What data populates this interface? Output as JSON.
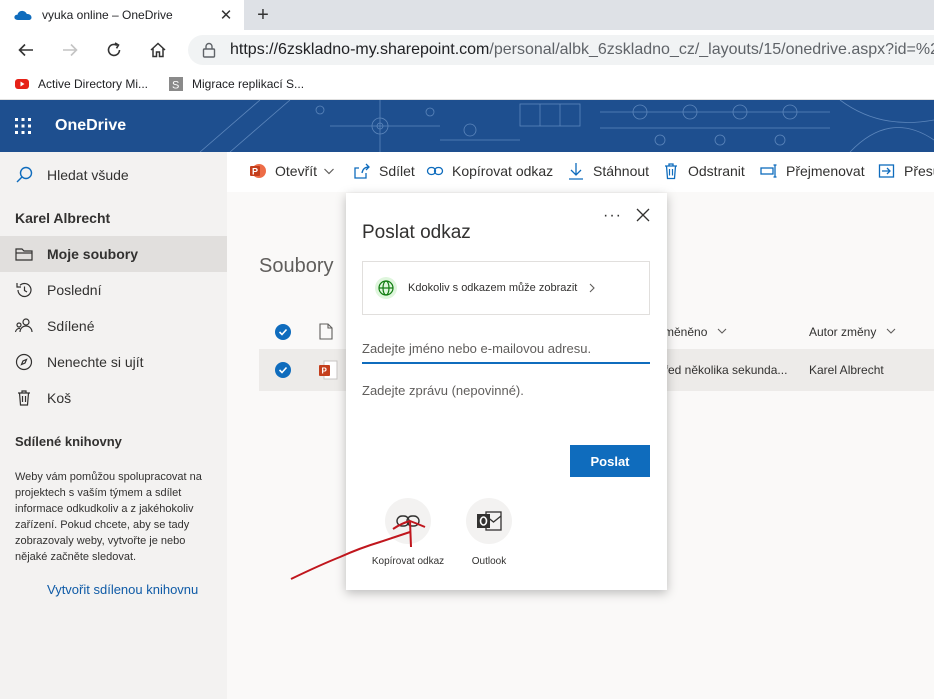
{
  "browser": {
    "tab_title": "vyuka online – OneDrive",
    "tab_close": "✕",
    "new_tab": "+",
    "url_host": "https://6zskladno-my.sharepoint.com",
    "url_path": "/personal/albk_6zskladno_cz/_layouts/15/onedrive.aspx?id=%2",
    "bookmarks": [
      "Active Directory Mi...",
      "Migrace replikací S..."
    ]
  },
  "suite": {
    "brand": "OneDrive"
  },
  "leftnav": {
    "search_label": "Hledat všude",
    "user_name": "Karel Albrecht",
    "items": [
      {
        "label": "Moje soubory",
        "icon": "folder-icon"
      },
      {
        "label": "Poslední",
        "icon": "history-icon"
      },
      {
        "label": "Sdílené",
        "icon": "people-icon"
      },
      {
        "label": "Nenechte si ujít",
        "icon": "diamond-icon"
      },
      {
        "label": "Koš",
        "icon": "trash-icon"
      }
    ],
    "shared_libraries_title": "Sdílené knihovny",
    "shared_libraries_text": "Weby vám pomůžou spolupracovat na projektech s vaším týmem a sdílet informace odkudkoliv a z jakéhokoliv zařízení. Pokud chcete, aby se tady zobrazovaly weby, vytvořte je nebo nějaké začněte sledovat.",
    "create_library_link": "Vytvořit sdílenou knihovnu"
  },
  "commandbar": {
    "open": "Otevřít",
    "share": "Sdílet",
    "copy_link": "Kopírovat odkaz",
    "download": "Stáhnout",
    "delete": "Odstranit",
    "rename": "Přejmenovat",
    "move": "Přesu"
  },
  "main": {
    "breadcrumb": "Soubory",
    "breadcrumb_sep": ">",
    "columns": {
      "modified": "měněno",
      "modified_by": "Autor změny"
    },
    "row": {
      "modified": "řed několika sekunda...",
      "modified_by": "Karel Albrecht"
    }
  },
  "dialog": {
    "title": "Poslat odkaz",
    "more": "···",
    "permission": "Kdokoliv s odkazem může zobrazit",
    "to_placeholder": "Zadejte jméno nebo e-mailovou adresu.",
    "message_placeholder": "Zadejte zprávu (nepovinné).",
    "send": "Poslat",
    "options": [
      {
        "label": "Kopírovat odkaz",
        "icon": "link-icon"
      },
      {
        "label": "Outlook",
        "icon": "outlook-icon"
      }
    ]
  },
  "colors": {
    "accent": "#0f6cbd",
    "suite_bar": "#1e4f8f",
    "annotation": "#c0161d"
  }
}
